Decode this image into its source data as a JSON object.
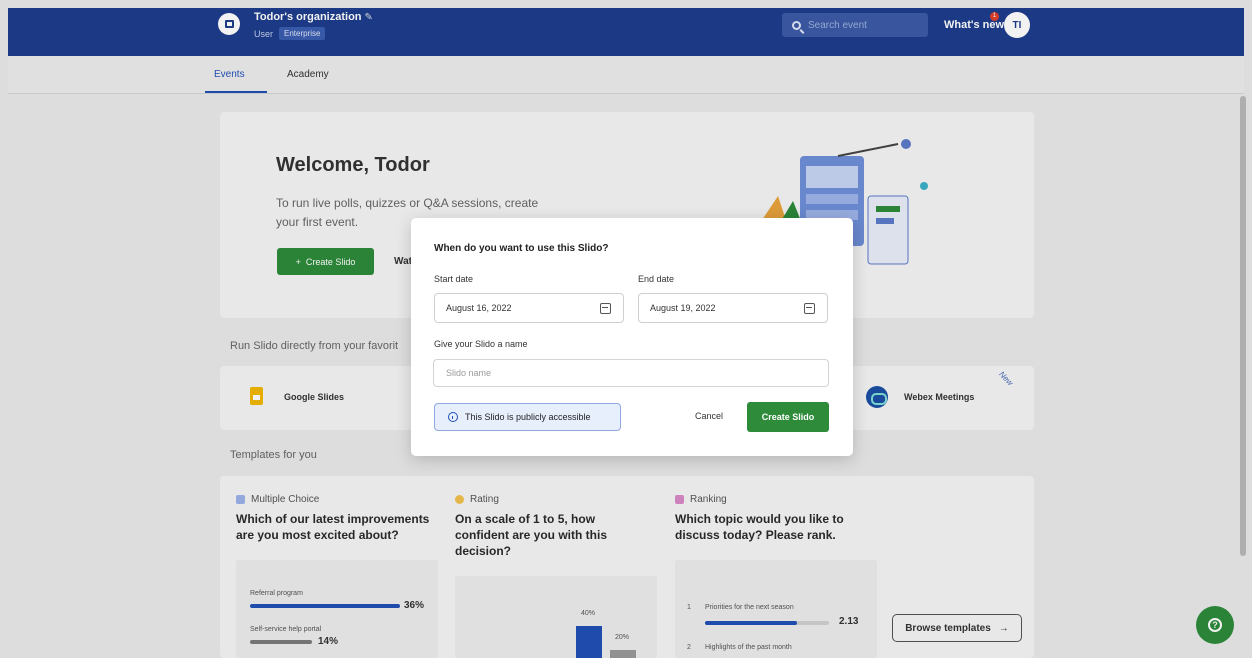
{
  "header": {
    "org_name": "Todor's organization",
    "role": "User",
    "plan_badge": "Enterprise",
    "search_placeholder": "Search event",
    "whats_new": "What's new",
    "notif_count": "1",
    "user_initials": "TI"
  },
  "tabs": [
    {
      "label": "Events",
      "active": true
    },
    {
      "label": "Academy",
      "active": false
    }
  ],
  "welcome": {
    "title": "Welcome, Todor",
    "text": "To run live polls, quizzes or Q&A sessions, create your first event.",
    "create_button": "Create Slido",
    "secondary_button": "Wat"
  },
  "integrations": {
    "label": "Run Slido directly from your favorit",
    "items": [
      {
        "name": "Google Slides",
        "icon": "google-slides-icon"
      },
      {
        "name": "Webex Meetings",
        "icon": "webex-icon",
        "badge": "New"
      }
    ]
  },
  "templates": {
    "label": "Templates for you",
    "items": [
      {
        "type": "Multiple Choice",
        "question": "Which of our latest improvements are you most excited about?",
        "color": "#9bb1e8"
      },
      {
        "type": "Rating",
        "question": "On a scale of 1 to 5, how confident are you with this decision?",
        "color": "#f2c14e"
      },
      {
        "type": "Ranking",
        "question": "Which topic would you like to discuss today? Please rank.",
        "color": "#d98ac9"
      }
    ],
    "mc_preview": [
      {
        "label": "Referral program",
        "value": "36%",
        "fraction": 0.36
      },
      {
        "label": "Self-service help portal",
        "value": "14%",
        "fraction": 0.14
      }
    ],
    "rating_preview": [
      {
        "label": "40%",
        "fraction": 0.4
      },
      {
        "label": "20%",
        "fraction": 0.2
      }
    ],
    "ranking_preview": [
      {
        "rank": "1",
        "label": "Priorities for the next season",
        "value": "2.13",
        "fraction": 0.7
      },
      {
        "rank": "2",
        "label": "Highlights of the past month"
      }
    ],
    "browse_button": "Browse templates"
  },
  "modal": {
    "title": "When do you want to use this Slido?",
    "start_label": "Start date",
    "start_value": "August 16, 2022",
    "end_label": "End date",
    "end_value": "August 19, 2022",
    "name_label": "Give your Slido a name",
    "name_placeholder": "Slido name",
    "public_text": "This Slido is publicly accessible",
    "cancel": "Cancel",
    "create": "Create Slido"
  },
  "colors": {
    "brand": "#1d3d8c",
    "accent": "#2150b7",
    "green": "#2e8b3a"
  }
}
